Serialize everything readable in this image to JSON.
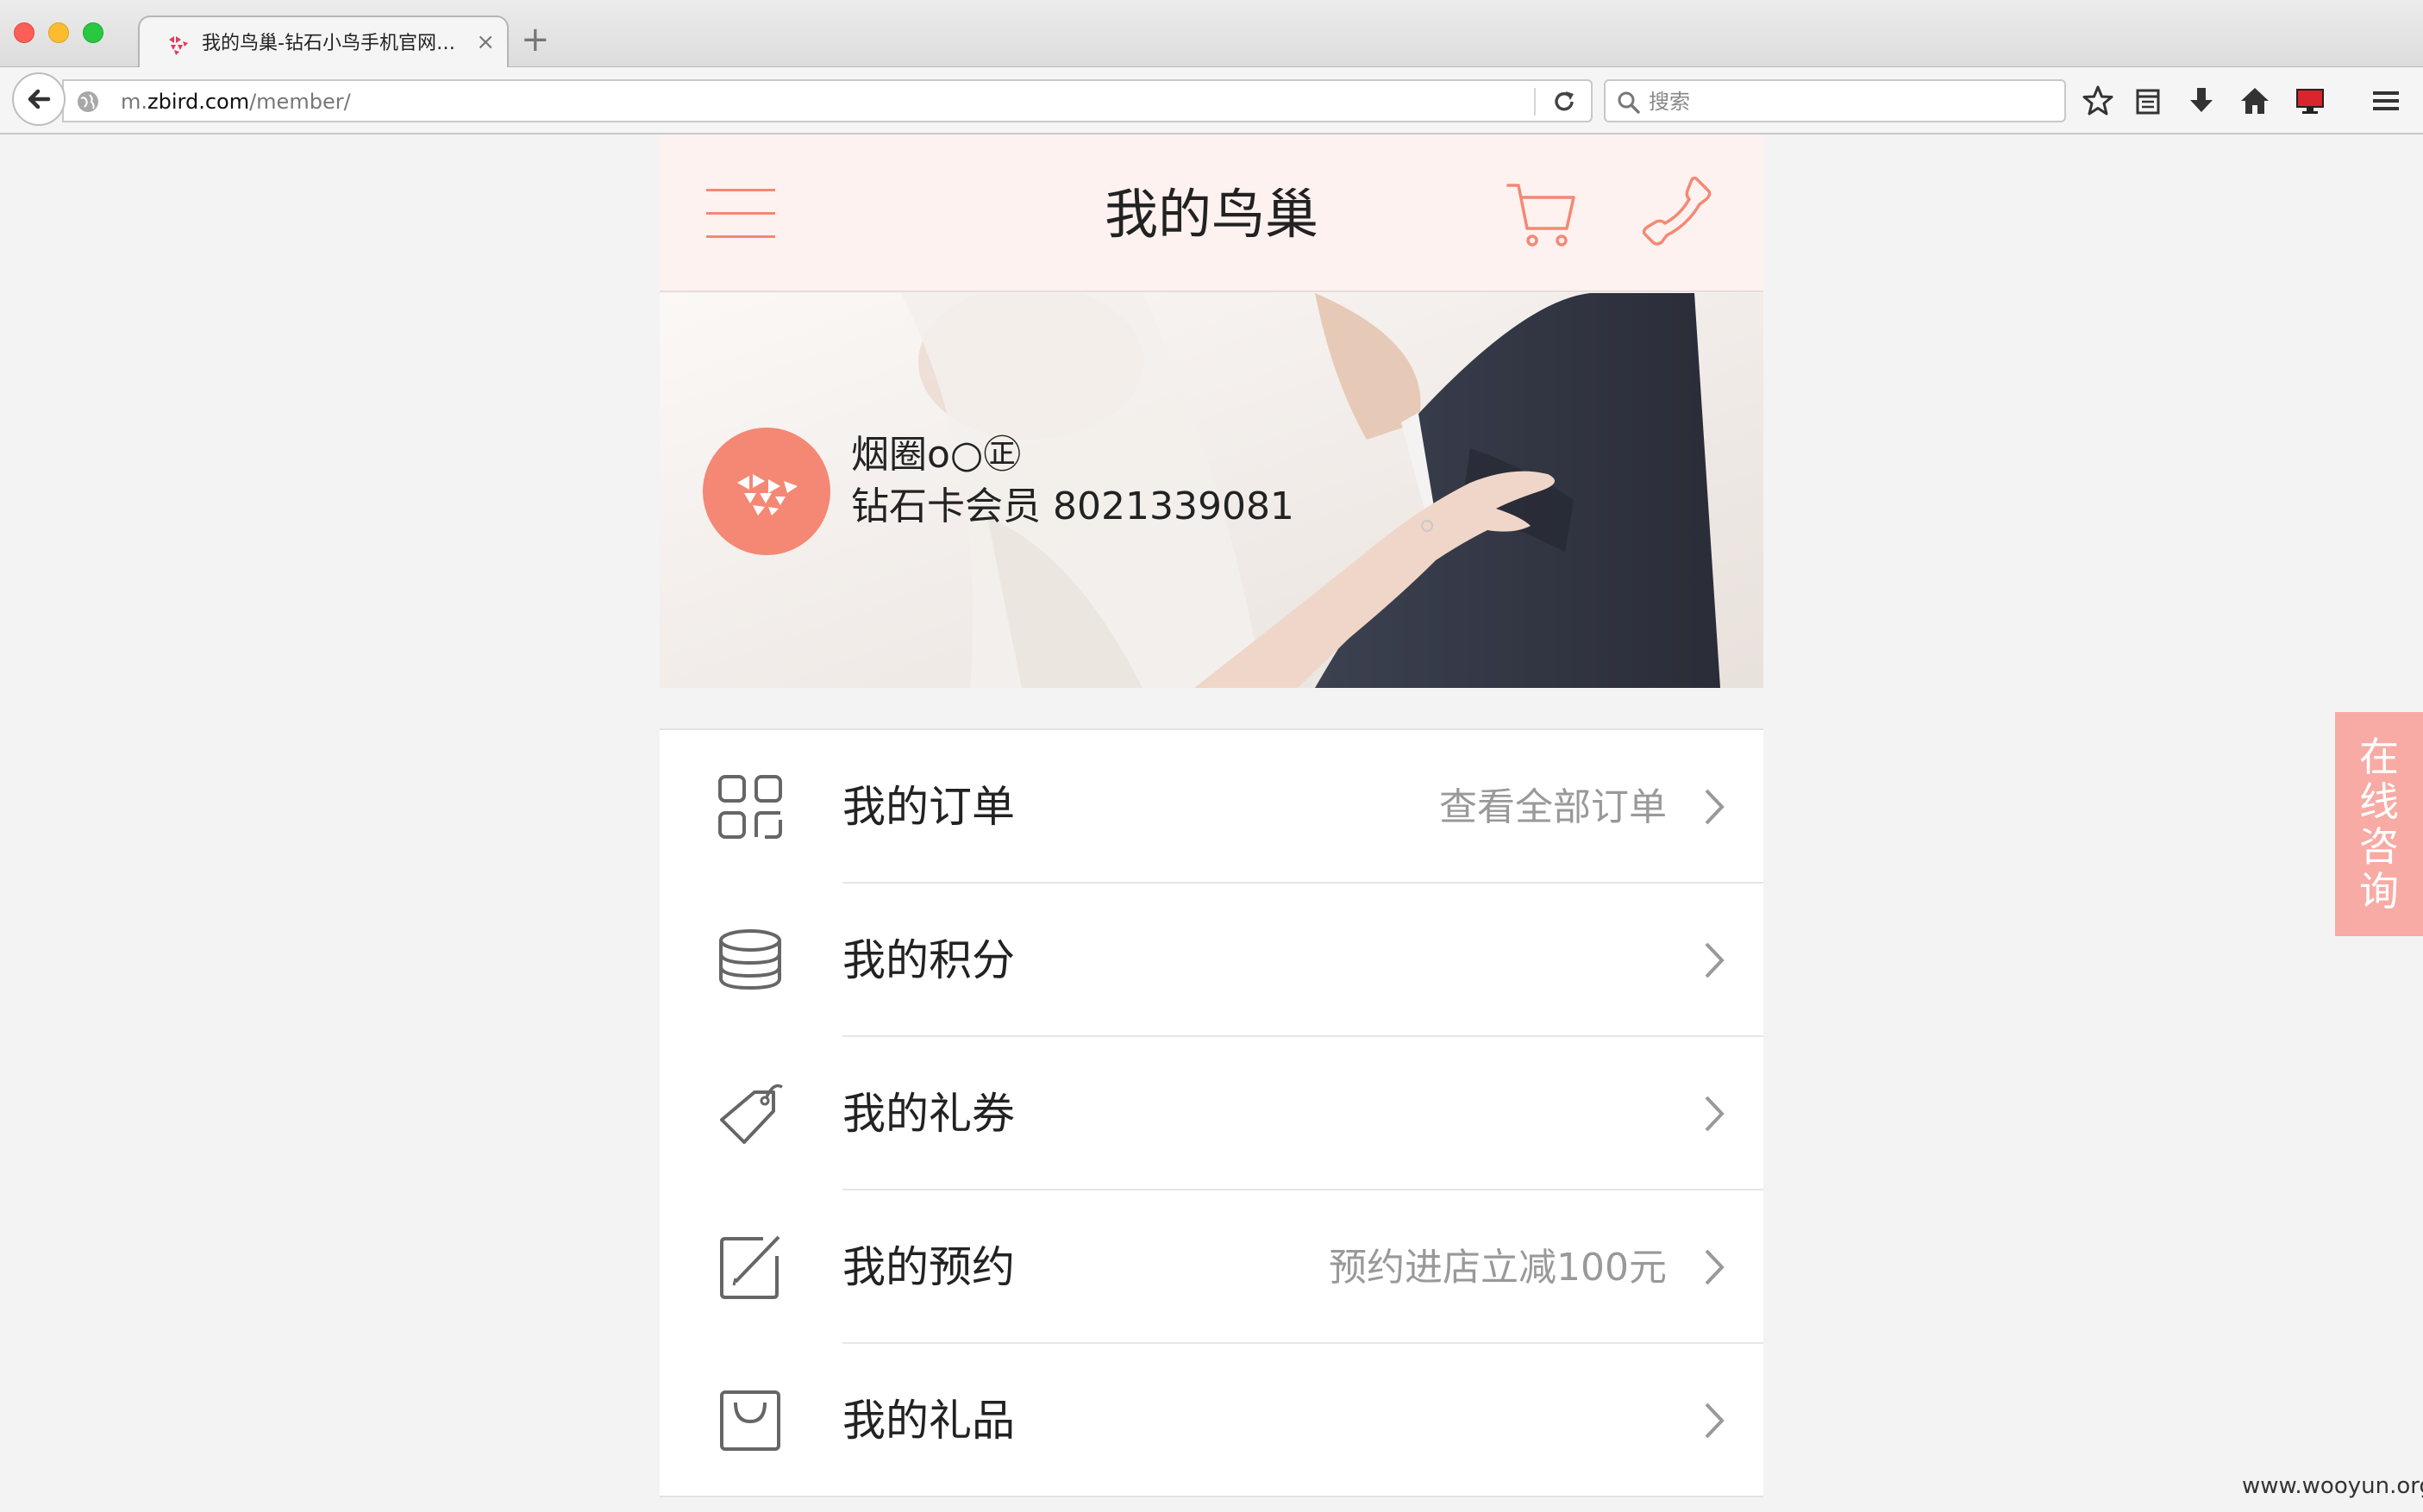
{
  "browser": {
    "tab_title": "我的鸟巢-钻石小鸟手机官网-...",
    "tab_close": "×",
    "new_tab": "+",
    "url_plain_prefix": "m.",
    "url_domain": "zbird.com",
    "url_path": "/member/",
    "search_placeholder": "搜索"
  },
  "header": {
    "title": "我的鸟巢"
  },
  "profile": {
    "name": "烟圈o○㊣",
    "level": "钻石卡会员 8021339081"
  },
  "menu": {
    "items": [
      {
        "label": "我的订单",
        "extra": "查看全部订单"
      },
      {
        "label": "我的积分",
        "extra": ""
      },
      {
        "label": "我的礼券",
        "extra": ""
      },
      {
        "label": "我的预约",
        "extra": "预约进店立减100元"
      },
      {
        "label": "我的礼品",
        "extra": ""
      }
    ]
  },
  "float_button": {
    "chars": [
      "在",
      "线",
      "咨",
      "询"
    ]
  },
  "watermark": "www.wooyun.org",
  "colors": {
    "accent": "#f48874",
    "header_bg": "#fdf2f0",
    "float_bg": "#f7aba4",
    "muted_text": "#999999"
  }
}
